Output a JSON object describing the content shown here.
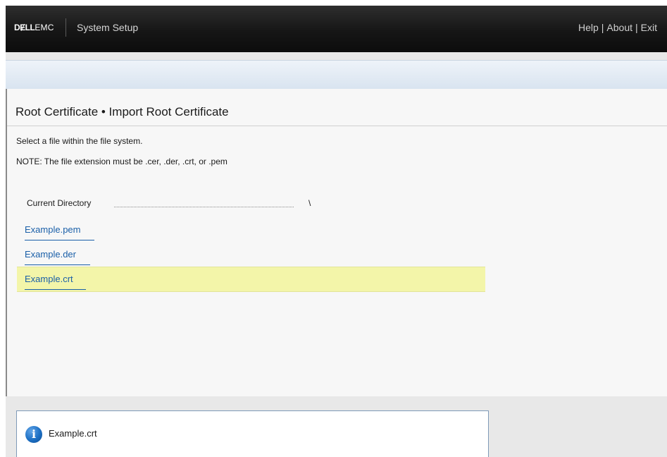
{
  "header": {
    "brand_dell": "DɆLL",
    "brand_emc": "EMC",
    "app_title": "System Setup",
    "links": [
      {
        "label": "Help"
      },
      {
        "label": "About"
      },
      {
        "label": "Exit"
      }
    ],
    "separator": "|"
  },
  "page": {
    "title": "Root Certificate • Import Root Certificate",
    "instruction": "Select a file within the file system.",
    "note": "NOTE: The file extension must be .cer, .der, .crt, or .pem"
  },
  "directory": {
    "label": "Current Directory",
    "value": "\\"
  },
  "files": [
    {
      "name": "Example.pem",
      "selected": false
    },
    {
      "name": "Example.der",
      "selected": false
    },
    {
      "name": "Example.crt",
      "selected": true
    }
  ],
  "status": {
    "icon": "info-icon",
    "icon_glyph": "i",
    "text": "Example.crt"
  },
  "colors": {
    "link": "#1a5fa8",
    "selected_row": "#f3f5a9",
    "header_bg": "#161616"
  }
}
